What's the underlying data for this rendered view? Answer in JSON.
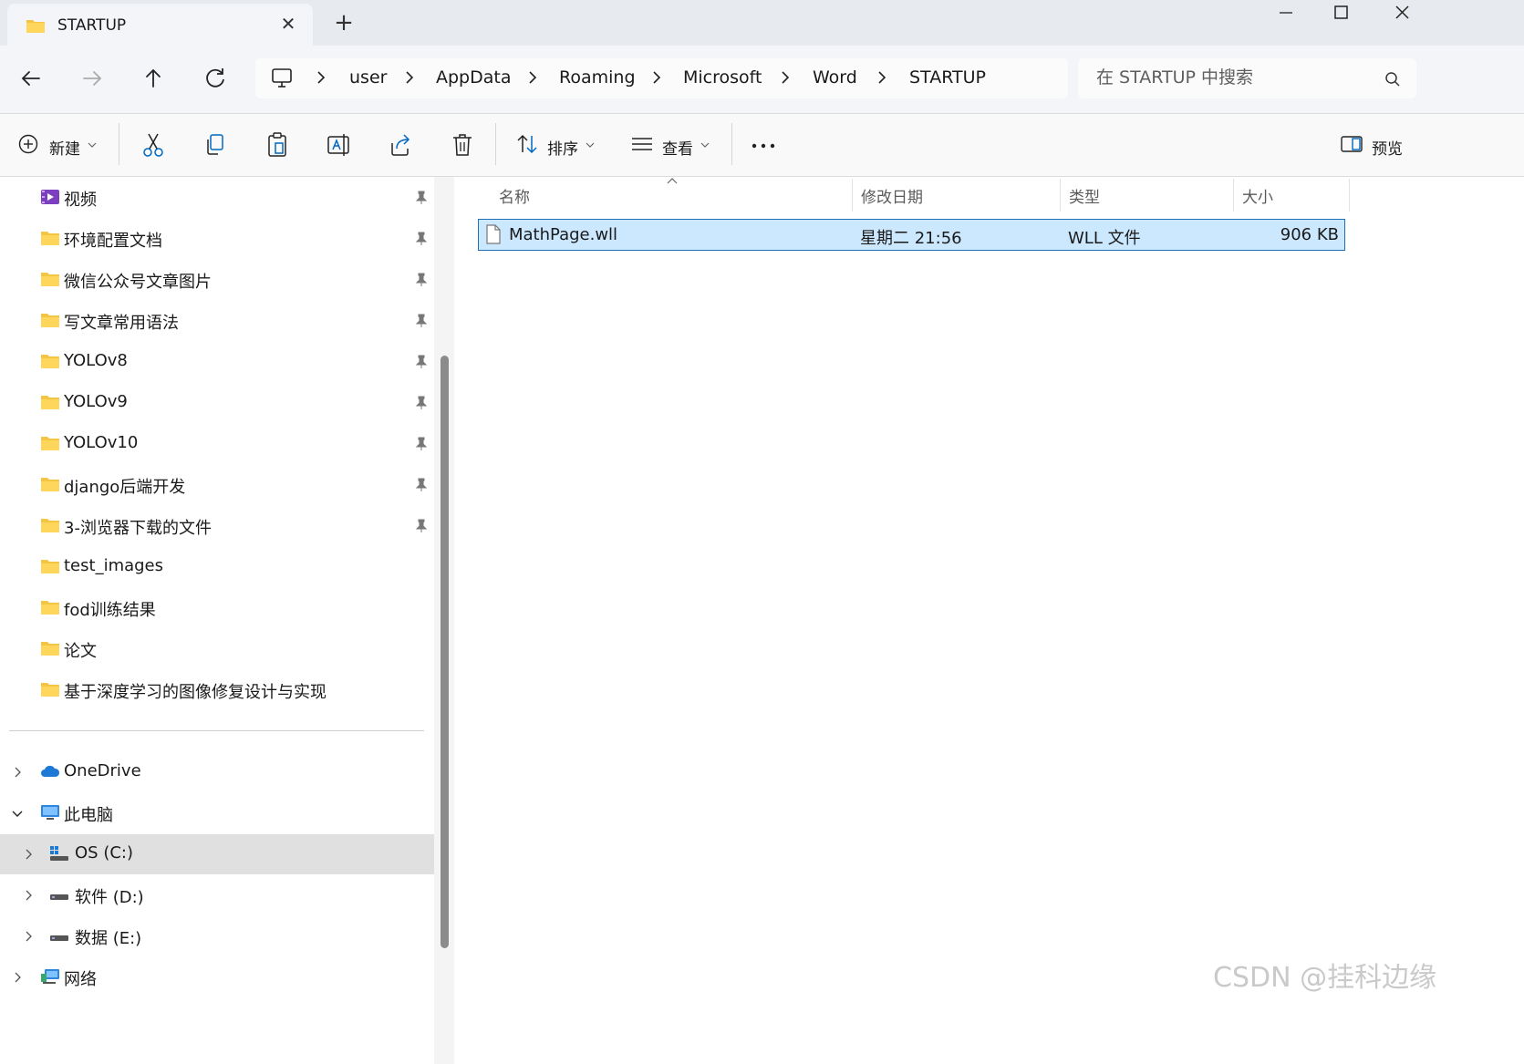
{
  "tab": {
    "title": "STARTUP",
    "new_tab": "+"
  },
  "address": {
    "crumbs": [
      "user",
      "AppData",
      "Roaming",
      "Microsoft",
      "Word",
      "STARTUP"
    ]
  },
  "search": {
    "placeholder": "在 STARTUP 中搜索"
  },
  "toolbar": {
    "new_label": "新建",
    "sort_label": "排序",
    "view_label": "查看",
    "preview_label": "预览"
  },
  "sidebar": {
    "quick_access": [
      {
        "label": "视频",
        "icon": "video-folder-icon",
        "pinned": true
      },
      {
        "label": "环境配置文档",
        "icon": "folder-icon",
        "pinned": true
      },
      {
        "label": "微信公众号文章图片",
        "icon": "folder-icon",
        "pinned": true
      },
      {
        "label": "写文章常用语法",
        "icon": "folder-icon",
        "pinned": true
      },
      {
        "label": "YOLOv8",
        "icon": "folder-icon",
        "pinned": true
      },
      {
        "label": "YOLOv9",
        "icon": "folder-icon",
        "pinned": true
      },
      {
        "label": "YOLOv10",
        "icon": "folder-icon",
        "pinned": true
      },
      {
        "label": "django后端开发",
        "icon": "folder-icon",
        "pinned": true
      },
      {
        "label": "3-浏览器下载的文件",
        "icon": "folder-icon",
        "pinned": true
      },
      {
        "label": "test_images",
        "icon": "folder-icon",
        "pinned": false
      },
      {
        "label": "fod训练结果",
        "icon": "folder-icon",
        "pinned": false
      },
      {
        "label": "论文",
        "icon": "folder-icon",
        "pinned": false
      },
      {
        "label": "基于深度学习的图像修复设计与实现",
        "icon": "folder-icon",
        "pinned": false
      }
    ],
    "onedrive": "OneDrive",
    "this_pc": "此电脑",
    "drives": [
      {
        "label": "OS (C:)",
        "icon": "windows-drive-icon",
        "selected": true
      },
      {
        "label": "软件 (D:)",
        "icon": "drive-icon",
        "selected": false
      },
      {
        "label": "数据 (E:)",
        "icon": "drive-icon",
        "selected": false
      }
    ],
    "network": "网络"
  },
  "columns": {
    "name": "名称",
    "modified": "修改日期",
    "type": "类型",
    "size": "大小"
  },
  "files": [
    {
      "name": "MathPage.wll",
      "modified": "星期二 21:56",
      "type": "WLL 文件",
      "size": "906 KB",
      "selected": true
    }
  ],
  "watermark": "CSDN @挂科边缘",
  "colors": {
    "selection_bg": "#cce8ff",
    "selection_border": "#1f6fb6",
    "folder": "#f4c542",
    "accent": "#0067c0"
  }
}
